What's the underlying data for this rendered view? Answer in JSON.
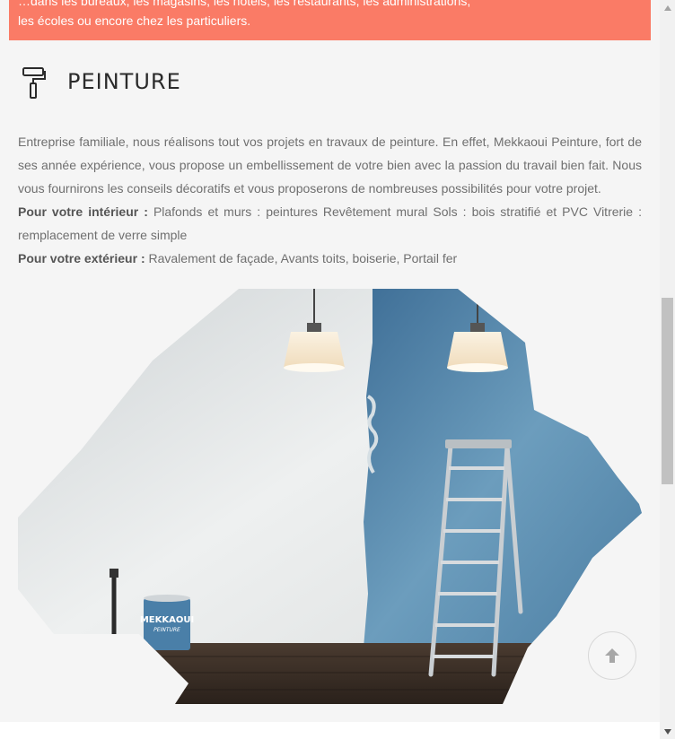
{
  "banner": {
    "line1": "…dans les bureaux, les magasins, les hôtels, les restaurants, les administrations,",
    "line2": "les écoles ou encore chez les particuliers.",
    "color": "#fa7b66"
  },
  "section": {
    "icon": "paint-roller-icon",
    "title": "PEINTURE",
    "paragraph": "Entreprise familiale, nous réalisons tout vos projets en travaux de peinture. En effet, Mekkaoui Peinture, fort de ses année expérience, vous propose un embellissement de votre bien avec la passion du travail bien fait. Nous vous fournirons les conseils décoratifs et vous proposerons de nombreuses possibilités pour votre projet.",
    "interior_label": "Pour votre intérieur :",
    "interior_text": " Plafonds et murs : peintures Revêtement mural Sols : bois stratifié et PVC Vitrerie : remplacement de verre simple",
    "exterior_label": "Pour votre extérieur :",
    "exterior_text": " Ravalement de façade, Avants toits, boiserie, Portail fer"
  },
  "photo": {
    "can_label_line1": "MEKKAOUI",
    "can_label_line2": "PEINTURE"
  },
  "scroll_top": {
    "icon": "arrow-up-icon"
  },
  "scrollbar": {
    "up_icon": "scroll-up-arrow-icon",
    "down_icon": "scroll-down-arrow-icon"
  }
}
